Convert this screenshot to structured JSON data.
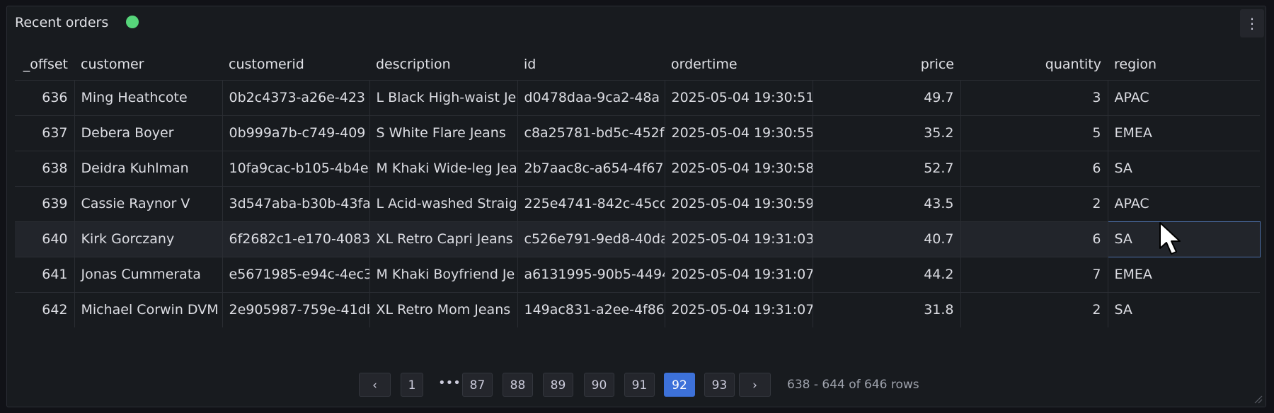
{
  "panel": {
    "title": "Recent orders",
    "status_color": "#56d57a",
    "menu_icon": "⋮"
  },
  "table": {
    "columns": [
      "_offset",
      "customer",
      "customerid",
      "description",
      "id",
      "ordertime",
      "price",
      "quantity",
      "region"
    ],
    "rows": [
      [
        "636",
        "Ming Heathcote",
        "0b2c4373-a26e-423",
        "L Black High-waist Je",
        "d0478daa-9ca2-48a",
        "2025-05-04 19:30:51",
        "49.7",
        "3",
        "APAC"
      ],
      [
        "637",
        "Debera Boyer",
        "0b999a7b-c749-409",
        "S White Flare Jeans",
        "c8a25781-bd5c-452f",
        "2025-05-04 19:30:55",
        "35.2",
        "5",
        "EMEA"
      ],
      [
        "638",
        "Deidra Kuhlman",
        "10fa9cac-b105-4b4e",
        "M Khaki Wide-leg Jea",
        "2b7aac8c-a654-4f67",
        "2025-05-04 19:30:58",
        "52.7",
        "6",
        "SA"
      ],
      [
        "639",
        "Cassie Raynor V",
        "3d547aba-b30b-43fa",
        "L Acid-washed Straig",
        "225e4741-842c-45cc",
        "2025-05-04 19:30:59",
        "43.5",
        "2",
        "APAC"
      ],
      [
        "640",
        "Kirk Gorczany",
        "6f2682c1-e170-4083",
        "XL Retro Capri Jeans",
        "c526e791-9ed8-40da",
        "2025-05-04 19:31:03",
        "40.7",
        "6",
        "SA"
      ],
      [
        "641",
        "Jonas Cummerata",
        "e5671985-e94c-4ec3",
        "M Khaki Boyfriend Je",
        "a6131995-90b5-4494",
        "2025-05-04 19:31:07",
        "44.2",
        "7",
        "EMEA"
      ],
      [
        "642",
        "Michael Corwin DVM",
        "2e905987-759e-41db",
        "XL Retro Mom Jeans",
        "149ac831-a2ee-4f86",
        "2025-05-04 19:31:07",
        "31.8",
        "2",
        "SA"
      ]
    ]
  },
  "pagination": {
    "prev": "‹",
    "next": "›",
    "first": "1",
    "ellipsis": "•••",
    "pages": [
      "87",
      "88",
      "89",
      "90",
      "91",
      "92",
      "93"
    ],
    "current": "92",
    "summary": "638 - 644 of 646 rows"
  }
}
